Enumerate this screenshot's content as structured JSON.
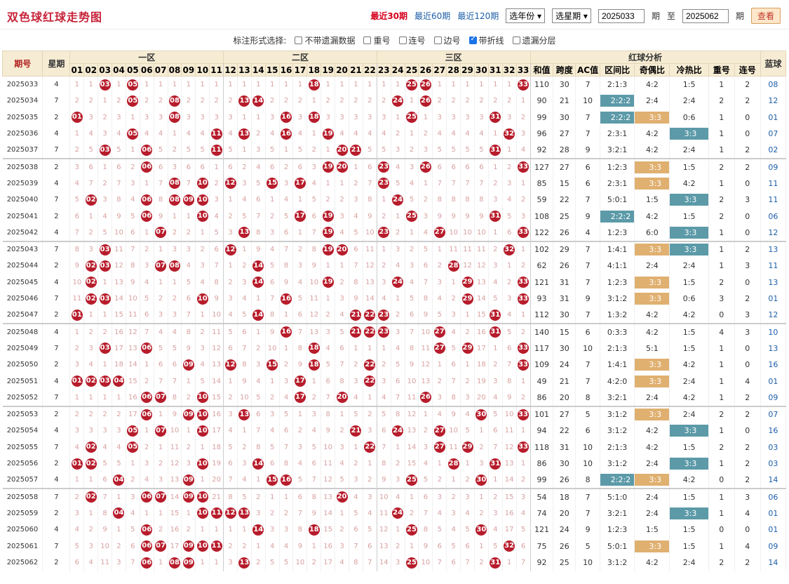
{
  "header": {
    "title": "双色球红球走势图",
    "links": [
      {
        "label": "最近30期",
        "active": true
      },
      {
        "label": "最近60期",
        "active": false
      },
      {
        "label": "最近120期",
        "active": false
      }
    ],
    "year_select": "选年份",
    "week_select": "选星期",
    "from_issue": "2025033",
    "period_label": "期",
    "to_label": "至",
    "to_issue": "2025062",
    "view_button": "查看"
  },
  "options": {
    "label": "标注形式选择:",
    "items": [
      {
        "label": "不带遗漏数据",
        "checked": false
      },
      {
        "label": "重号",
        "checked": false
      },
      {
        "label": "连号",
        "checked": false
      },
      {
        "label": "边号",
        "checked": false
      },
      {
        "label": "带折线",
        "checked": true
      },
      {
        "label": "遗漏分层",
        "checked": false
      }
    ]
  },
  "table": {
    "col_issue": "期号",
    "col_week": "星期",
    "zones": [
      "一区",
      "二区",
      "三区"
    ],
    "analysis_title": "红球分析",
    "analysis_cols": [
      "和值",
      "跨度",
      "AC值",
      "区间比",
      "奇偶比",
      "冷热比",
      "重号",
      "连号"
    ],
    "col_blue": "蓝球",
    "numbers": [
      "01",
      "02",
      "03",
      "04",
      "05",
      "06",
      "07",
      "08",
      "09",
      "10",
      "11",
      "12",
      "13",
      "14",
      "15",
      "16",
      "17",
      "18",
      "19",
      "20",
      "21",
      "22",
      "23",
      "24",
      "25",
      "26",
      "27",
      "28",
      "29",
      "30",
      "31",
      "32",
      "33"
    ],
    "rows": [
      {
        "issue": "2025033",
        "week": "4",
        "red": [
          3,
          5,
          18,
          25,
          26,
          33
        ],
        "sum": "110",
        "span": "30",
        "ac": "7",
        "zone": "2:1:3",
        "oe": "4:2",
        "ch": "1:5",
        "rep": "1",
        "con": "2",
        "blue": "08"
      },
      {
        "issue": "2025034",
        "week": "7",
        "red": [
          5,
          8,
          13,
          14,
          24,
          26
        ],
        "sum": "90",
        "span": "21",
        "ac": "10",
        "zone": "2:2:2",
        "oe": "2:4",
        "ch": "2:4",
        "rep": "2",
        "con": "2",
        "blue": "12",
        "zone_tag": "teal"
      },
      {
        "issue": "2025035",
        "week": "2",
        "red": [
          1,
          8,
          16,
          18,
          25,
          31
        ],
        "sum": "99",
        "span": "30",
        "ac": "7",
        "zone": "2:2:2",
        "oe": "3:3",
        "ch": "0:6",
        "rep": "1",
        "con": "0",
        "blue": "01",
        "zone_tag": "teal",
        "oe_tag": "gold"
      },
      {
        "issue": "2025036",
        "week": "4",
        "red": [
          5,
          11,
          13,
          16,
          19,
          32
        ],
        "sum": "96",
        "span": "27",
        "ac": "7",
        "zone": "2:3:1",
        "oe": "4:2",
        "ch": "3:3",
        "rep": "1",
        "con": "0",
        "blue": "07",
        "ch_tag": "teal"
      },
      {
        "issue": "2025037",
        "week": "7",
        "red": [
          3,
          6,
          11,
          20,
          21,
          31
        ],
        "sum": "92",
        "span": "28",
        "ac": "9",
        "zone": "3:2:1",
        "oe": "4:2",
        "ch": "2:4",
        "rep": "1",
        "con": "2",
        "blue": "02"
      },
      {
        "issue": "2025038",
        "week": "2",
        "red": [
          6,
          19,
          20,
          23,
          26,
          33
        ],
        "sum": "127",
        "span": "27",
        "ac": "6",
        "zone": "1:2:3",
        "oe": "3:3",
        "ch": "1:5",
        "rep": "2",
        "con": "2",
        "blue": "09",
        "oe_tag": "gold"
      },
      {
        "issue": "2025039",
        "week": "4",
        "red": [
          8,
          10,
          12,
          15,
          17,
          23
        ],
        "sum": "85",
        "span": "15",
        "ac": "6",
        "zone": "2:3:1",
        "oe": "3:3",
        "ch": "4:2",
        "rep": "1",
        "con": "0",
        "blue": "11",
        "oe_tag": "gold"
      },
      {
        "issue": "2025040",
        "week": "7",
        "red": [
          2,
          6,
          8,
          9,
          10,
          24
        ],
        "sum": "59",
        "span": "22",
        "ac": "7",
        "zone": "5:0:1",
        "oe": "1:5",
        "ch": "3:3",
        "rep": "2",
        "con": "3",
        "blue": "11",
        "ch_tag": "teal"
      },
      {
        "issue": "2025041",
        "week": "2",
        "red": [
          6,
          10,
          17,
          19,
          25,
          31
        ],
        "sum": "108",
        "span": "25",
        "ac": "9",
        "zone": "2:2:2",
        "oe": "4:2",
        "ch": "1:5",
        "rep": "2",
        "con": "0",
        "blue": "06",
        "zone_tag": "teal"
      },
      {
        "issue": "2025042",
        "week": "4",
        "red": [
          7,
          13,
          19,
          23,
          27,
          33
        ],
        "sum": "122",
        "span": "26",
        "ac": "4",
        "zone": "1:2:3",
        "oe": "6:0",
        "ch": "3:3",
        "rep": "1",
        "con": "0",
        "blue": "12",
        "ch_tag": "teal"
      },
      {
        "issue": "2025043",
        "week": "7",
        "red": [
          3,
          12,
          19,
          20,
          32
        ],
        "sum": "102",
        "span": "29",
        "ac": "7",
        "zone": "1:4:1",
        "oe": "3:3",
        "ch": "3:3",
        "rep": "1",
        "con": "2",
        "blue": "13",
        "oe_tag": "gold",
        "ch_tag": "teal"
      },
      {
        "issue": "2025044",
        "week": "2",
        "red": [
          2,
          3,
          7,
          8,
          14,
          28
        ],
        "sum": "62",
        "span": "26",
        "ac": "7",
        "zone": "4:1:1",
        "oe": "2:4",
        "ch": "2:4",
        "rep": "1",
        "con": "3",
        "blue": "11"
      },
      {
        "issue": "2025045",
        "week": "4",
        "red": [
          2,
          14,
          19,
          24,
          29,
          33
        ],
        "sum": "121",
        "span": "31",
        "ac": "7",
        "zone": "1:2:3",
        "oe": "3:3",
        "ch": "1:5",
        "rep": "2",
        "con": "0",
        "blue": "13",
        "oe_tag": "gold"
      },
      {
        "issue": "2025046",
        "week": "7",
        "red": [
          2,
          3,
          10,
          16,
          29,
          33
        ],
        "sum": "93",
        "span": "31",
        "ac": "9",
        "zone": "3:1:2",
        "oe": "3:3",
        "ch": "0:6",
        "rep": "3",
        "con": "2",
        "blue": "01",
        "oe_tag": "gold"
      },
      {
        "issue": "2025047",
        "week": "2",
        "red": [
          1,
          14,
          21,
          22,
          23,
          31
        ],
        "sum": "112",
        "span": "30",
        "ac": "7",
        "zone": "1:3:2",
        "oe": "4:2",
        "ch": "4:2",
        "rep": "0",
        "con": "3",
        "blue": "12"
      },
      {
        "issue": "2025048",
        "week": "4",
        "red": [
          16,
          21,
          22,
          23,
          27,
          31
        ],
        "sum": "140",
        "span": "15",
        "ac": "6",
        "zone": "0:3:3",
        "oe": "4:2",
        "ch": "1:5",
        "rep": "4",
        "con": "3",
        "blue": "10"
      },
      {
        "issue": "2025049",
        "week": "7",
        "red": [
          3,
          6,
          18,
          27,
          29,
          33
        ],
        "sum": "117",
        "span": "30",
        "ac": "10",
        "zone": "2:1:3",
        "oe": "5:1",
        "ch": "1:5",
        "rep": "1",
        "con": "0",
        "blue": "13"
      },
      {
        "issue": "2025050",
        "week": "2",
        "red": [
          9,
          12,
          15,
          18,
          22,
          33
        ],
        "sum": "109",
        "span": "24",
        "ac": "7",
        "zone": "1:4:1",
        "oe": "3:3",
        "ch": "4:2",
        "rep": "1",
        "con": "0",
        "blue": "16",
        "oe_tag": "gold"
      },
      {
        "issue": "2025051",
        "week": "4",
        "red": [
          1,
          2,
          3,
          4,
          17,
          22
        ],
        "sum": "49",
        "span": "21",
        "ac": "7",
        "zone": "4:2:0",
        "oe": "3:3",
        "ch": "2:4",
        "rep": "1",
        "con": "4",
        "blue": "01",
        "oe_tag": "gold"
      },
      {
        "issue": "2025052",
        "week": "7",
        "red": [
          6,
          7,
          10,
          17,
          20,
          26
        ],
        "sum": "86",
        "span": "20",
        "ac": "8",
        "zone": "3:2:1",
        "oe": "2:4",
        "ch": "4:2",
        "rep": "1",
        "con": "2",
        "blue": "09"
      },
      {
        "issue": "2025053",
        "week": "2",
        "red": [
          6,
          9,
          10,
          13,
          30,
          33
        ],
        "sum": "101",
        "span": "27",
        "ac": "5",
        "zone": "3:1:2",
        "oe": "3:3",
        "ch": "2:4",
        "rep": "2",
        "con": "2",
        "blue": "07",
        "oe_tag": "gold"
      },
      {
        "issue": "2025054",
        "week": "4",
        "red": [
          5,
          7,
          10,
          21,
          24,
          27
        ],
        "sum": "94",
        "span": "22",
        "ac": "6",
        "zone": "3:1:2",
        "oe": "4:2",
        "ch": "3:3",
        "rep": "1",
        "con": "0",
        "blue": "16",
        "ch_tag": "teal"
      },
      {
        "issue": "2025055",
        "week": "7",
        "red": [
          2,
          5,
          22,
          27,
          29,
          33
        ],
        "sum": "118",
        "span": "31",
        "ac": "10",
        "zone": "2:1:3",
        "oe": "4:2",
        "ch": "1:5",
        "rep": "2",
        "con": "2",
        "blue": "03"
      },
      {
        "issue": "2025056",
        "week": "2",
        "red": [
          1,
          2,
          10,
          14,
          28,
          31
        ],
        "sum": "86",
        "span": "30",
        "ac": "10",
        "zone": "3:1:2",
        "oe": "2:4",
        "ch": "3:3",
        "rep": "1",
        "con": "2",
        "blue": "03",
        "ch_tag": "teal"
      },
      {
        "issue": "2025057",
        "week": "4",
        "red": [
          4,
          9,
          15,
          16,
          25,
          30
        ],
        "sum": "99",
        "span": "26",
        "ac": "8",
        "zone": "2:2:2",
        "oe": "3:3",
        "ch": "4:2",
        "rep": "0",
        "con": "2",
        "blue": "14",
        "zone_tag": "teal",
        "oe_tag": "gold"
      },
      {
        "issue": "2025058",
        "week": "7",
        "red": [
          2,
          6,
          7,
          9,
          10,
          20
        ],
        "sum": "54",
        "span": "18",
        "ac": "7",
        "zone": "5:1:0",
        "oe": "2:4",
        "ch": "1:5",
        "rep": "1",
        "con": "3",
        "blue": "06"
      },
      {
        "issue": "2025059",
        "week": "2",
        "red": [
          4,
          10,
          11,
          12,
          13,
          24
        ],
        "sum": "74",
        "span": "20",
        "ac": "7",
        "zone": "3:2:1",
        "oe": "2:4",
        "ch": "3:3",
        "rep": "1",
        "con": "4",
        "blue": "01",
        "ch_tag": "teal"
      },
      {
        "issue": "2025060",
        "week": "4",
        "red": [
          6,
          14,
          18,
          25,
          30
        ],
        "sum": "121",
        "span": "24",
        "ac": "9",
        "zone": "1:2:3",
        "oe": "1:5",
        "ch": "1:5",
        "rep": "0",
        "con": "0",
        "blue": "01"
      },
      {
        "issue": "2025061",
        "week": "7",
        "red": [
          6,
          7,
          9,
          10,
          11,
          32
        ],
        "sum": "75",
        "span": "26",
        "ac": "5",
        "zone": "5:0:1",
        "oe": "3:3",
        "ch": "1:5",
        "rep": "1",
        "con": "4",
        "blue": "09",
        "oe_tag": "gold"
      },
      {
        "issue": "2025062",
        "week": "2",
        "red": [
          6,
          8,
          9,
          13,
          25,
          31
        ],
        "sum": "92",
        "span": "25",
        "ac": "10",
        "zone": "3:1:2",
        "oe": "4:2",
        "ch": "2:4",
        "rep": "2",
        "con": "2",
        "blue": "14"
      }
    ]
  }
}
